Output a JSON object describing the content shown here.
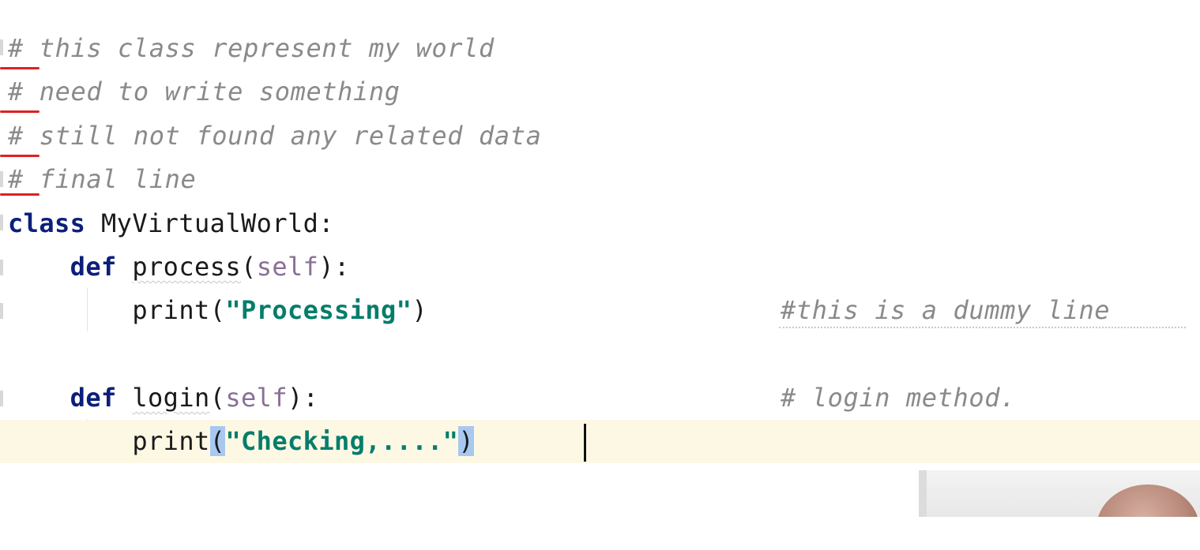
{
  "editor": {
    "lines": {
      "l1": "# this class represent my world",
      "l2": "# need to write something",
      "l3": "# still not found any related data",
      "l4": "# final line",
      "l5_kw": "class",
      "l5_name": " MyVirtualWorld:",
      "l6_indent": "    ",
      "l6_kw": "def",
      "l6_name": "process",
      "l6_open": "(",
      "l6_self": "self",
      "l6_close": "):",
      "l7_indent": "        ",
      "l7_fn": "print",
      "l7_open": "(",
      "l7_str": "\"Processing\"",
      "l7_close": ")",
      "l7_comment": "#this is a dummy line",
      "l9_kw": "def",
      "l9_name": "login",
      "l9_open": "(",
      "l9_self": "self",
      "l9_close": "):",
      "l9_comment": "# login method.",
      "l10_fn": "print",
      "l10_open": "(",
      "l10_str": "\"Checking,....\"",
      "l10_close": ")"
    }
  },
  "colors": {
    "comment": "#8a8a8a",
    "keyword": "#0b1f7a",
    "string": "#067d6b",
    "self_param": "#8a6f96",
    "current_line_bg": "#fdf8e4",
    "brace_match_bg": "#a8c8f0",
    "error_underline": "#e02020"
  }
}
